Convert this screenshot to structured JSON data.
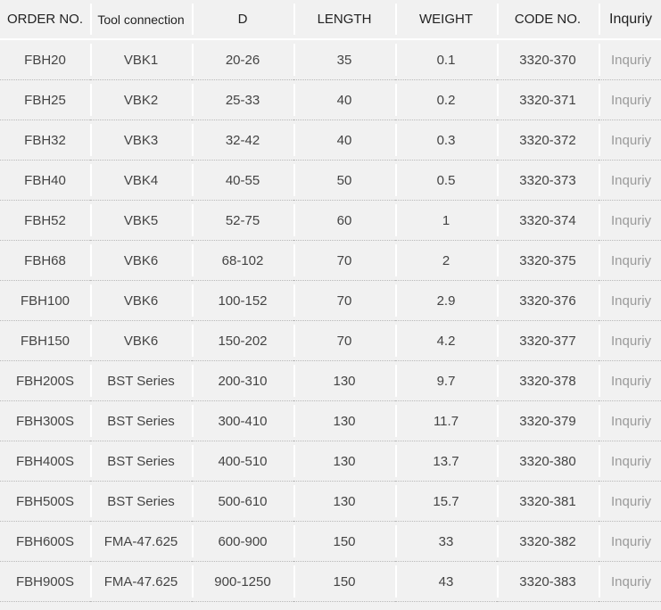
{
  "table": {
    "headers": [
      "ORDER NO.",
      "Tool connection",
      "D",
      "LENGTH",
      "WEIGHT",
      "CODE NO.",
      "Inquriy"
    ],
    "rows": [
      [
        "FBH20",
        "VBK1",
        "20-26",
        "35",
        "0.1",
        "3320-370",
        "Inquriy"
      ],
      [
        "FBH25",
        "VBK2",
        "25-33",
        "40",
        "0.2",
        "3320-371",
        "Inquriy"
      ],
      [
        "FBH32",
        "VBK3",
        "32-42",
        "40",
        "0.3",
        "3320-372",
        "Inquriy"
      ],
      [
        "FBH40",
        "VBK4",
        "40-55",
        "50",
        "0.5",
        "3320-373",
        "Inquriy"
      ],
      [
        "FBH52",
        "VBK5",
        "52-75",
        "60",
        "1",
        "3320-374",
        "Inquriy"
      ],
      [
        "FBH68",
        "VBK6",
        "68-102",
        "70",
        "2",
        "3320-375",
        "Inquriy"
      ],
      [
        "FBH100",
        "VBK6",
        "100-152",
        "70",
        "2.9",
        "3320-376",
        "Inquriy"
      ],
      [
        "FBH150",
        "VBK6",
        "150-202",
        "70",
        "4.2",
        "3320-377",
        "Inquriy"
      ],
      [
        "FBH200S",
        "BST Series",
        "200-310",
        "130",
        "9.7",
        "3320-378",
        "Inquriy"
      ],
      [
        "FBH300S",
        "BST Series",
        "300-410",
        "130",
        "11.7",
        "3320-379",
        "Inquriy"
      ],
      [
        "FBH400S",
        "BST Series",
        "400-510",
        "130",
        "13.7",
        "3320-380",
        "Inquriy"
      ],
      [
        "FBH500S",
        "BST Series",
        "500-610",
        "130",
        "15.7",
        "3320-381",
        "Inquriy"
      ],
      [
        "FBH600S",
        "FMA-47.625",
        "600-900",
        "150",
        "33",
        "3320-382",
        "Inquriy"
      ],
      [
        "FBH900S",
        "FMA-47.625",
        "900-1250",
        "150",
        "43",
        "3320-383",
        "Inquriy"
      ]
    ]
  }
}
